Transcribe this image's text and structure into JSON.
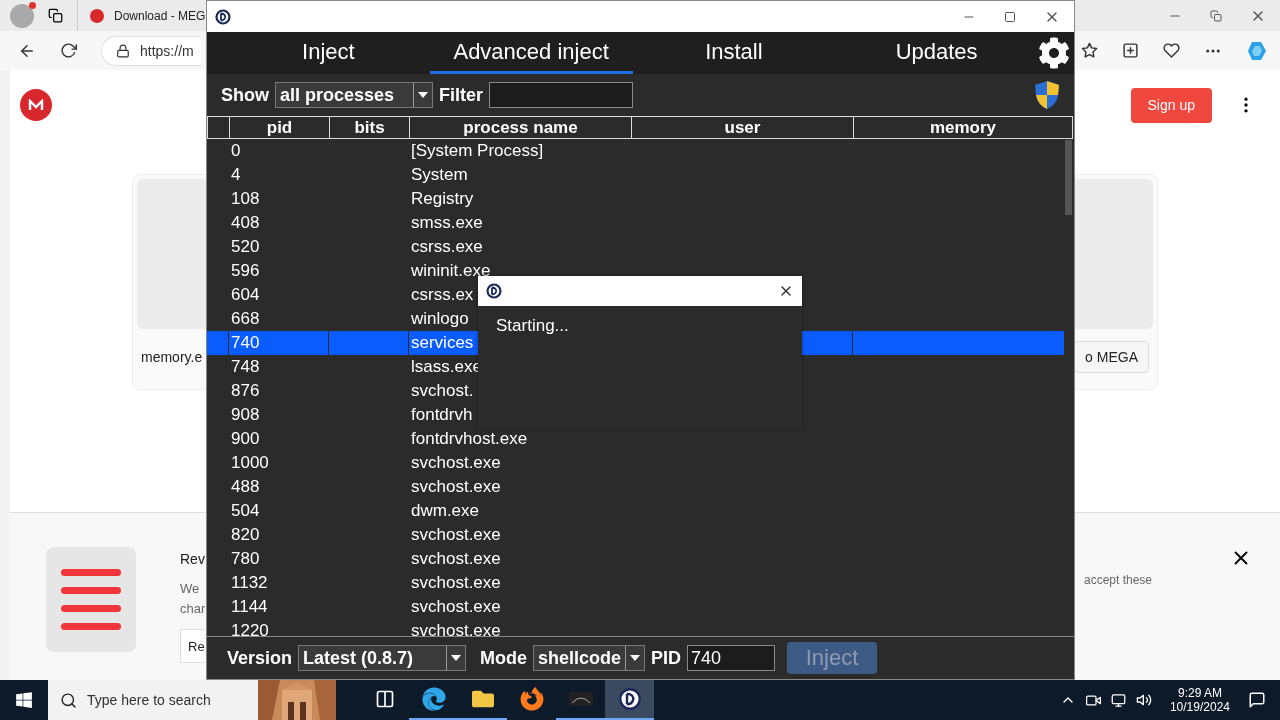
{
  "browser": {
    "tab_title": "Download - MEG",
    "address": "https://m",
    "signup_button": "Sign up",
    "card_caption": "memory.e",
    "card_button": "o MEGA",
    "banner": {
      "title": "Rev",
      "line_1": "We",
      "line_2": "char",
      "button": "Re",
      "text_right": "accept these"
    }
  },
  "app": {
    "tabs": [
      {
        "label": "Inject",
        "selected": false
      },
      {
        "label": "Advanced inject",
        "selected": true
      },
      {
        "label": "Install",
        "selected": false
      },
      {
        "label": "Updates",
        "selected": false
      }
    ],
    "show_label": "Show",
    "show_value": "all processes",
    "filter_label": "Filter",
    "columns": [
      "pid",
      "bits",
      "process name",
      "user",
      "memory"
    ],
    "rows": [
      {
        "pid": "0",
        "name": "[System Process]",
        "selected": false
      },
      {
        "pid": "4",
        "name": "System",
        "selected": false
      },
      {
        "pid": "108",
        "name": "Registry",
        "selected": false
      },
      {
        "pid": "408",
        "name": "smss.exe",
        "selected": false
      },
      {
        "pid": "520",
        "name": "csrss.exe",
        "selected": false
      },
      {
        "pid": "596",
        "name": "wininit.exe",
        "selected": false
      },
      {
        "pid": "604",
        "name": "csrss.ex",
        "selected": false
      },
      {
        "pid": "668",
        "name": "winlogo",
        "selected": false
      },
      {
        "pid": "740",
        "name": "services",
        "selected": true
      },
      {
        "pid": "748",
        "name": "lsass.exe",
        "selected": false
      },
      {
        "pid": "876",
        "name": "svchost.",
        "selected": false
      },
      {
        "pid": "908",
        "name": "fontdrvh",
        "selected": false
      },
      {
        "pid": "900",
        "name": "fontdrvhost.exe",
        "selected": false
      },
      {
        "pid": "1000",
        "name": "svchost.exe",
        "selected": false
      },
      {
        "pid": "488",
        "name": "svchost.exe",
        "selected": false
      },
      {
        "pid": "504",
        "name": "dwm.exe",
        "selected": false
      },
      {
        "pid": "820",
        "name": "svchost.exe",
        "selected": false
      },
      {
        "pid": "780",
        "name": "svchost.exe",
        "selected": false
      },
      {
        "pid": "1132",
        "name": "svchost.exe",
        "selected": false
      },
      {
        "pid": "1144",
        "name": "svchost.exe",
        "selected": false
      },
      {
        "pid": "1220",
        "name": "svchost.exe",
        "selected": false
      }
    ],
    "footer": {
      "version_label": "Version",
      "version_value": "Latest (0.8.7)",
      "mode_label": "Mode",
      "mode_value": "shellcode",
      "pid_label": "PID",
      "pid_value": "740",
      "inject_button": {
        "label": "Inject",
        "disabled": true
      }
    }
  },
  "dialog": {
    "message": "Starting..."
  },
  "taskbar": {
    "search_placeholder": "Type here to search",
    "apps": [
      {
        "kind": "task-view",
        "running": false,
        "active": false
      },
      {
        "kind": "edge",
        "running": true,
        "active": false
      },
      {
        "kind": "explorer",
        "running": true,
        "active": false
      },
      {
        "kind": "firefox",
        "running": false,
        "active": false
      },
      {
        "kind": "dark-app",
        "running": true,
        "active": false
      },
      {
        "kind": "injector",
        "running": true,
        "active": true
      }
    ],
    "time": "9:29 AM",
    "date": "10/19/2024"
  }
}
